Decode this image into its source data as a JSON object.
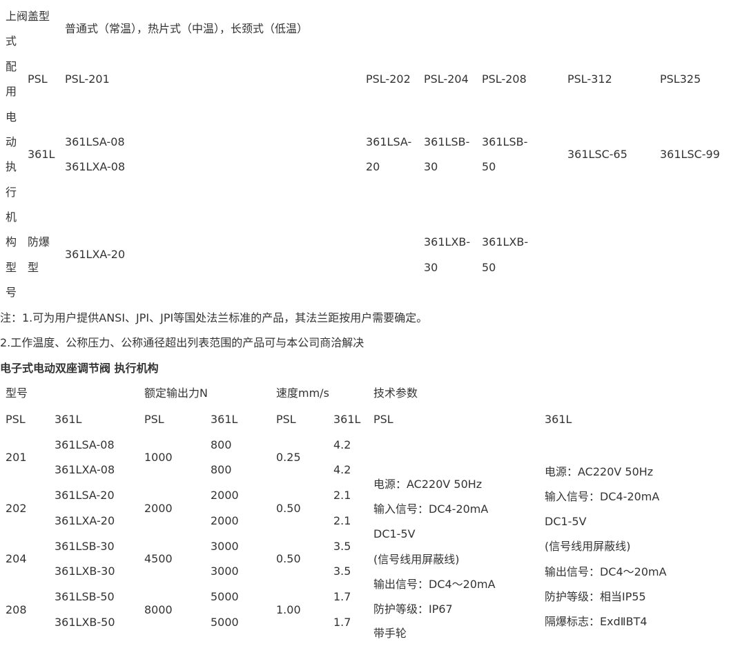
{
  "upper": {
    "title_a": "上阀盖型",
    "title_vertical": [
      "式",
      "配",
      "用",
      "电",
      "动",
      "执",
      "行",
      "机",
      "构",
      "型",
      "号"
    ],
    "bonnet_types": "普通式（常温），热片式（中温），长颈式（低温）",
    "psl_label": "PSL",
    "psl_models": [
      "PSL-201",
      "PSL-202",
      "PSL-204",
      "PSL-208",
      "PSL-312",
      "PSL325"
    ],
    "l361_label": "361L",
    "l361": {
      "c1": [
        "361LSA-08",
        "361LXA-08"
      ],
      "c2": [
        "361LSA-",
        "20"
      ],
      "c3": [
        "361LSB-",
        "30"
      ],
      "c4": [
        "361LSB-",
        "50"
      ],
      "c5": "361LSC-65",
      "c6": "361LSC-99"
    },
    "expl_label": [
      "防爆",
      "型"
    ],
    "expl": {
      "c1": "361LXA-20",
      "c3": [
        "361LXB-",
        "30"
      ],
      "c4": [
        "361LXB-",
        "50"
      ]
    }
  },
  "notes": [
    "注：1.可为用户提供ANSI、JPI、JPI等国处法兰标准的产品，其法兰距按用户需要确定。",
    "2.工作温度、公称压力、公称通径超出列表范围的产品可与本公司商洽解决"
  ],
  "section_title": "电子式电动双座调节阀 执行机构",
  "table2": {
    "headers": [
      "型号",
      "额定输出力N",
      "速度mm/s",
      "技术参数"
    ],
    "subheaders": [
      "PSL",
      "361L",
      "PSL",
      "361L",
      "PSL",
      "361L",
      "PSL",
      "361L"
    ],
    "rows": [
      {
        "psl": "201",
        "models": [
          "361LSA-08",
          "361LXA-08"
        ],
        "force_psl": "1000",
        "force_361": [
          "800",
          "800"
        ],
        "speed_psl": "0.25",
        "speed_361": [
          "4.2",
          "4.2"
        ]
      },
      {
        "psl": "202",
        "models": [
          "361LSA-20",
          "361LXA-20"
        ],
        "force_psl": "2000",
        "force_361": [
          "2000",
          "2000"
        ],
        "speed_psl": "0.50",
        "speed_361": [
          "2.1",
          "2.1"
        ]
      },
      {
        "psl": "204",
        "models": [
          "361LSB-30",
          "361LXB-30"
        ],
        "force_psl": "4500",
        "force_361": [
          "3000",
          "3000"
        ],
        "speed_psl": "0.50",
        "speed_361": [
          "3.5",
          "3.5"
        ]
      },
      {
        "psl": "208",
        "models": [
          "361LSB-50",
          "361LXB-50"
        ],
        "force_psl": "8000",
        "force_361": [
          "5000",
          "5000"
        ],
        "speed_psl": "1.00",
        "speed_361": [
          "1.7",
          "1.7"
        ]
      }
    ],
    "tech_psl": [
      "电源：AC220V 50Hz",
      "输入信号：DC4-20mA",
      "DC1-5V",
      "(信号线用屏蔽线)",
      "输出信号：DC4～20mA",
      "防护等级：IP67",
      "带手轮"
    ],
    "tech_361": [
      "电源：AC220V 50Hz",
      "输入信号：DC4-20mA",
      "DC1-5V",
      "(信号线用屏蔽线)",
      "输出信号：DC4～20mA",
      "防护等级：相当IP55",
      "隔爆标志：ExdⅡBT4"
    ]
  }
}
